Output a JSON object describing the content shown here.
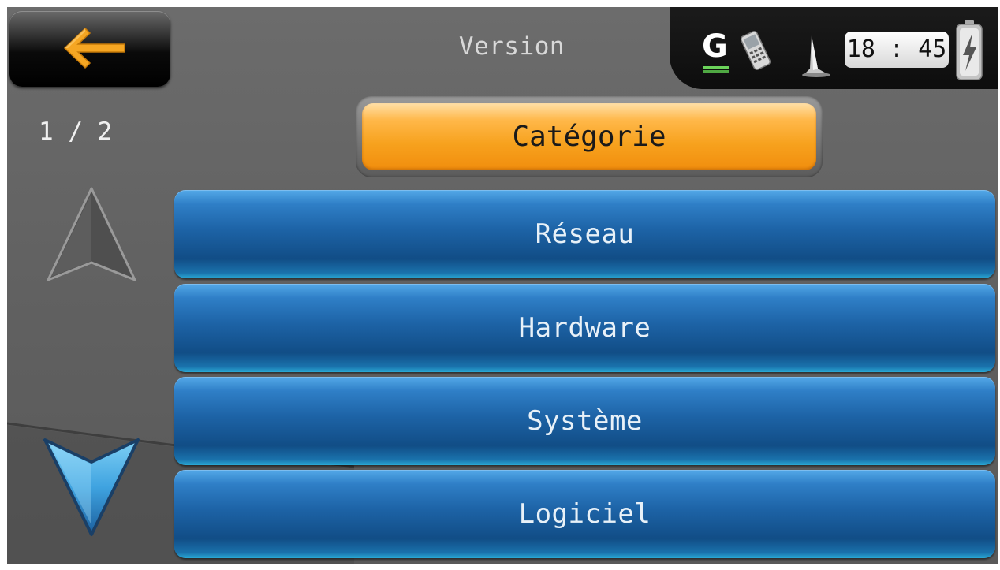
{
  "header": {
    "title": "Version",
    "back_icon": "arrow-left-icon"
  },
  "status": {
    "gps_label": "G",
    "clock": "18 : 45",
    "icons": [
      "gps-signal-icon",
      "phone-icon",
      "satellite-icon",
      "battery-charging-icon"
    ]
  },
  "nav": {
    "page_indicator": "1 / 2",
    "up_icon": "arrow-up-icon",
    "down_icon": "arrow-down-icon"
  },
  "category": {
    "label": "Catégorie"
  },
  "list": {
    "items": [
      {
        "label": "Réseau"
      },
      {
        "label": "Hardware"
      },
      {
        "label": "Système"
      },
      {
        "label": "Logiciel"
      }
    ]
  },
  "colors": {
    "accent_orange": "#f7a21e",
    "item_blue": "#1d63a6",
    "down_arrow_blue": "#3fa3e0",
    "background_grey": "#626262"
  }
}
